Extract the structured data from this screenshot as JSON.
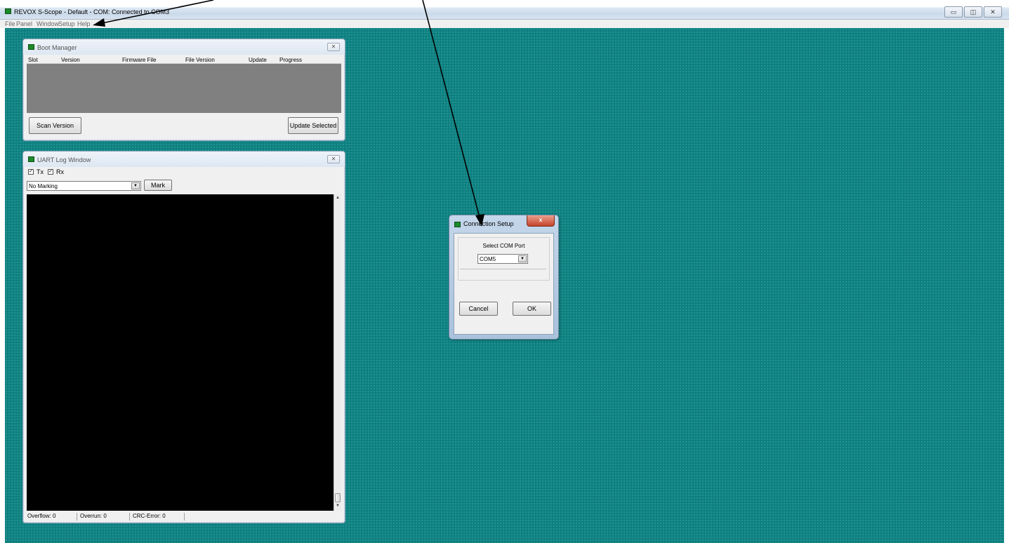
{
  "app": {
    "title": "REVOX S-Scope - Default - COM: Connected to COM3",
    "caption_buttons": [
      "▭",
      "◫",
      "✕"
    ]
  },
  "menu": [
    "File",
    "Panel",
    "Window",
    "Setup",
    "Help"
  ],
  "boot_manager": {
    "title": "Boot Manager",
    "close": "✕",
    "columns": [
      "Slot",
      "Version",
      "Firmware File",
      "File Version",
      "Update",
      "Progress"
    ],
    "scan_button": "Scan Version",
    "update_button": "Update Selected"
  },
  "uart_log": {
    "title": "UART Log Window",
    "close": "✕",
    "tx_label": "Tx",
    "rx_label": "Rx",
    "tx_checked": true,
    "rx_checked": true,
    "marking_value": "No Marking",
    "mark_button": "Mark",
    "status": {
      "overflow": "Overflow: 0",
      "overrun": "Overrun: 0",
      "crc_error": "CRC-Error: 0"
    }
  },
  "connection_dialog": {
    "title": "Connection Setup",
    "close": "x",
    "group_label": "Select COM Port",
    "com_value": "COM5",
    "cancel_button": "Cancel",
    "ok_button": "OK"
  },
  "colors": {
    "desktop": "#0e8080",
    "annotation_arrow": "#000000"
  }
}
